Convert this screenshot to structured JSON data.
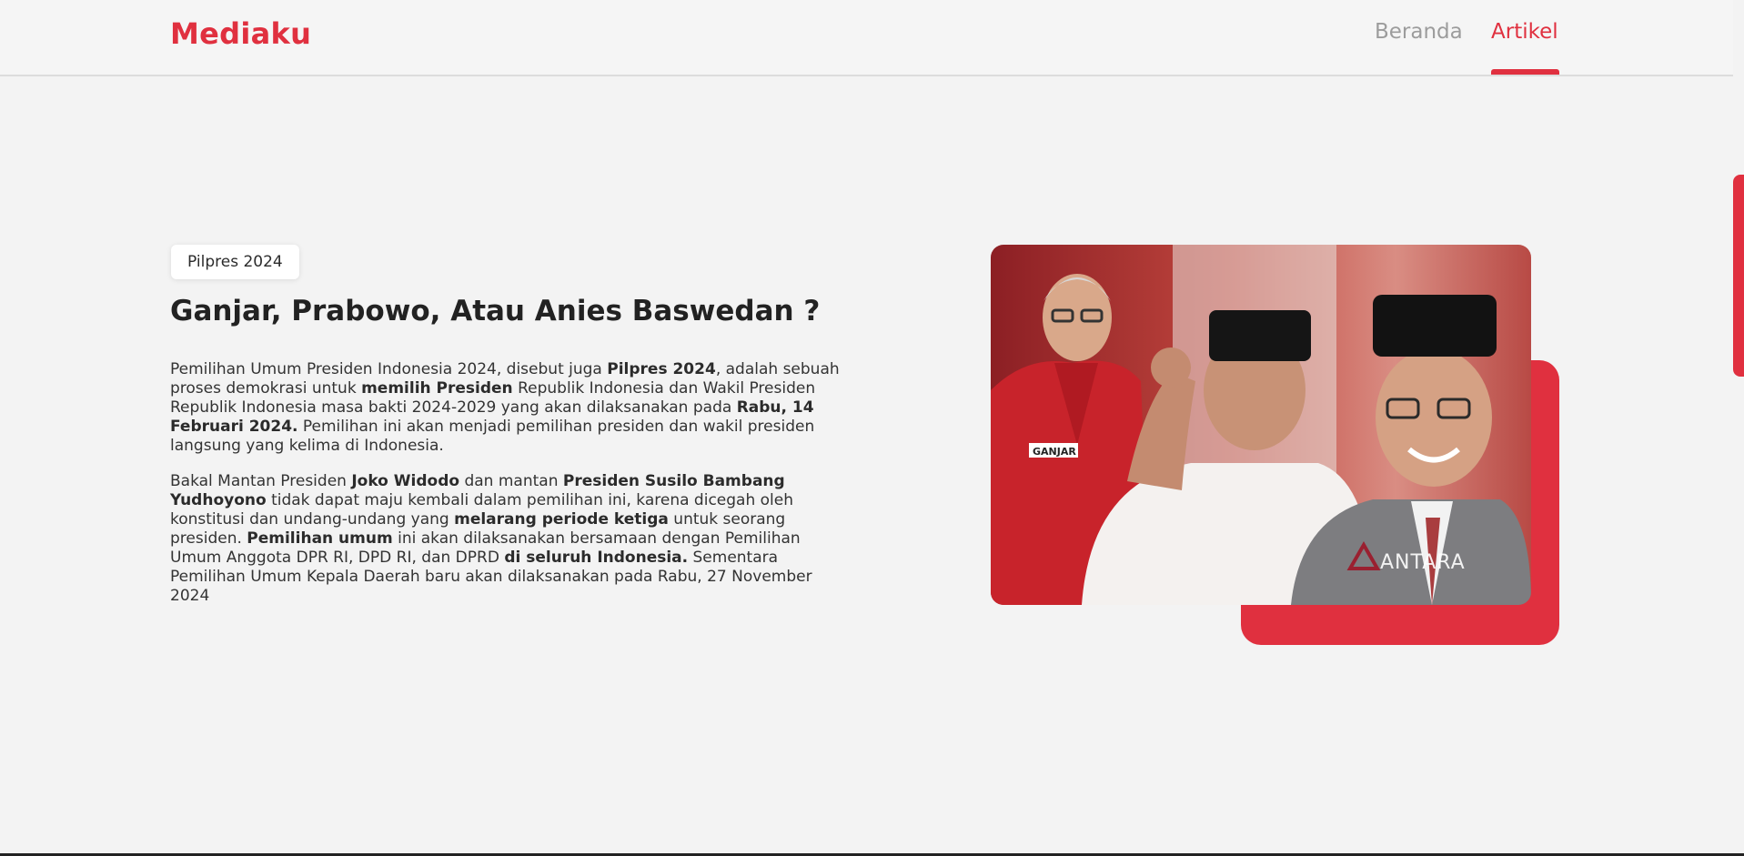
{
  "navbar": {
    "brand": "Mediaku",
    "links": [
      {
        "label": "Beranda",
        "active": false
      },
      {
        "label": "Artikel",
        "active": true
      }
    ]
  },
  "article": {
    "tag": "Pilpres 2024",
    "title": "Ganjar, Prabowo, Atau Anies Baswedan ?",
    "paragraph1": [
      {
        "text": "Pemilihan Umum Presiden Indonesia 2024, disebut juga ",
        "bold": false
      },
      {
        "text": "Pilpres 2024",
        "bold": true
      },
      {
        "text": ", adalah sebuah proses demokrasi untuk ",
        "bold": false
      },
      {
        "text": "memilih Presiden",
        "bold": true
      },
      {
        "text": " Republik Indonesia dan Wakil Presiden Republik Indonesia masa bakti 2024-2029 yang akan dilaksanakan pada ",
        "bold": false
      },
      {
        "text": "Rabu, 14 Februari 2024.",
        "bold": true
      },
      {
        "text": " Pemilihan ini akan menjadi pemilihan presiden dan wakil presiden langsung yang kelima di Indonesia.",
        "bold": false
      }
    ],
    "paragraph2": [
      {
        "text": "Bakal Mantan Presiden ",
        "bold": false
      },
      {
        "text": "Joko Widodo",
        "bold": true
      },
      {
        "text": " dan mantan ",
        "bold": false
      },
      {
        "text": "Presiden Susilo Bambang Yudhoyono",
        "bold": true
      },
      {
        "text": " tidak dapat maju kembali dalam pemilihan ini, karena dicegah oleh konstitusi dan undang-undang yang ",
        "bold": false
      },
      {
        "text": "melarang periode ketiga",
        "bold": true
      },
      {
        "text": " untuk seorang presiden. ",
        "bold": false
      },
      {
        "text": "Pemilihan umum",
        "bold": true
      },
      {
        "text": " ini akan dilaksanakan bersamaan dengan Pemilihan Umum Anggota DPR RI, DPD RI, dan DPRD ",
        "bold": false
      },
      {
        "text": "di seluruh Indonesia.",
        "bold": true
      },
      {
        "text": " Sementara Pemilihan Umum Kepala Daerah baru akan dilaksanakan pada Rabu, 27 November 2024",
        "bold": false
      }
    ]
  },
  "hero_image": {
    "watermark": "ANTARA",
    "badge_text": "GANJAR"
  },
  "colors": {
    "accent": "#e0303f",
    "background": "#f3f3f3",
    "text": "#2b2b2b",
    "muted_link": "#9c9c9c"
  }
}
